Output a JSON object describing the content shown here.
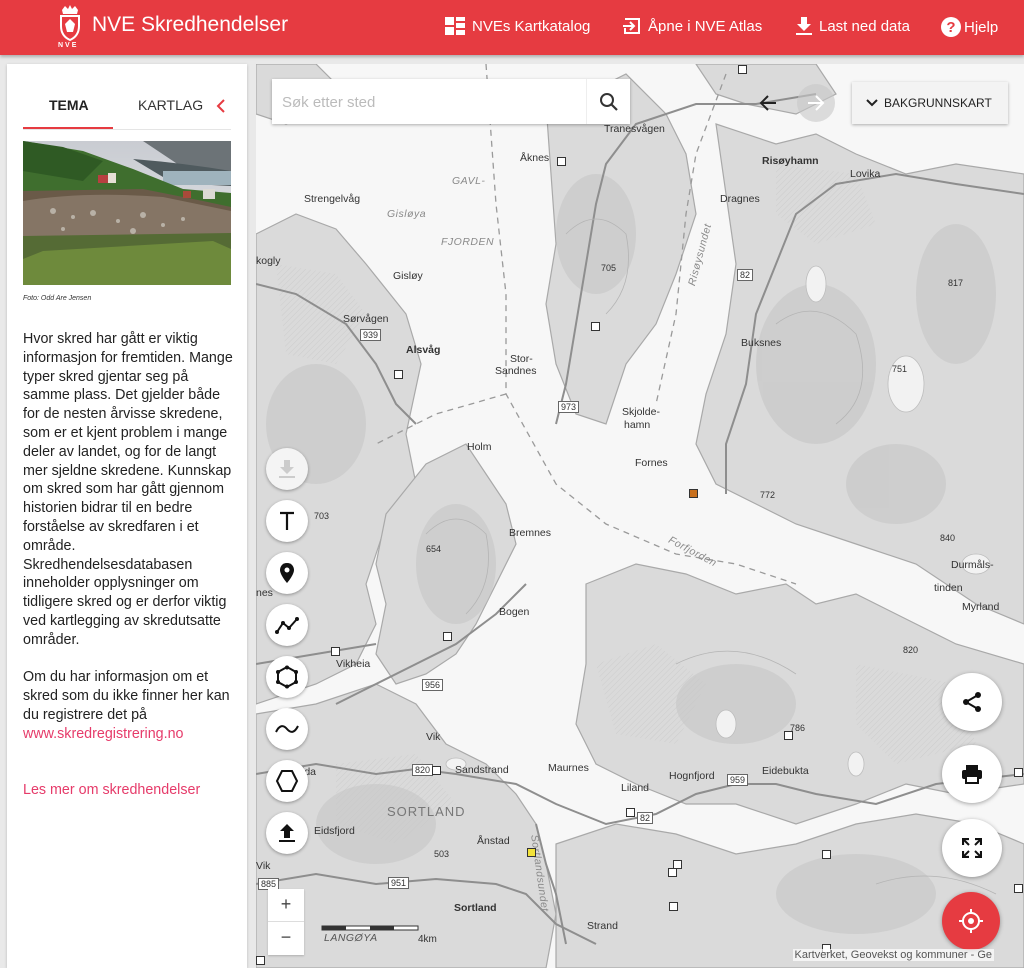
{
  "header": {
    "logo_text": "NVE",
    "title": "NVE Skredhendelser",
    "nav": [
      {
        "label": "NVEs Kartkatalog",
        "icon": "grid-icon"
      },
      {
        "label": "Åpne i NVE Atlas",
        "icon": "open-in-icon"
      },
      {
        "label": "Last ned data",
        "icon": "download-icon"
      },
      {
        "label": "Hjelp",
        "icon": "help-icon"
      }
    ]
  },
  "sidebar": {
    "tabs": [
      "TEMA",
      "KARTLAG"
    ],
    "active_tab": "TEMA",
    "photo_credit": "Foto: Odd Are Jensen",
    "intro": "Hvor skred har gått er viktig informasjon for fremtiden. Mange typer skred gjentar seg på samme plass. Det gjelder både for de nesten årvisse skredene, som er et kjent problem i mange deler av landet, og for de langt mer sjeldne skredene. Kunnskap om skred som har gått gjennom historien bidrar til en bedre forståelse av skredfaren i et område. Skredhendelsesdatabasen inneholder opplysninger om tidligere skred og er derfor viktig ved kartlegging av skredutsatte områder.",
    "register_text": "Om du har informasjon om et skred som du ikke finner her kan du registrere det på",
    "register_link": "www.skredregistrering.no",
    "read_more": "Les mer om skredhendelser"
  },
  "map": {
    "search_placeholder": "Søk etter sted",
    "basemap_button": "BAKGRUNNSKART",
    "scale_label": "4km",
    "attribution": "Kartverket, Geovekst og kommuner - Ge",
    "places": [
      {
        "name": "Tranesvågen"
      },
      {
        "name": "Åknes"
      },
      {
        "name": "Risøyhamn"
      },
      {
        "name": "Lovika"
      },
      {
        "name": "GAVL-"
      },
      {
        "name": "Strengelvåg"
      },
      {
        "name": "Gisløya"
      },
      {
        "name": "Dragnes"
      },
      {
        "name": "FJORDEN"
      },
      {
        "name": "kogly"
      },
      {
        "name": "Gisløy"
      },
      {
        "name": "705"
      },
      {
        "name": "817"
      },
      {
        "name": "Risøysundet"
      },
      {
        "name": "Sørvågen"
      },
      {
        "name": "Alsvåg"
      },
      {
        "name": "Buksnes"
      },
      {
        "name": "Stor-"
      },
      {
        "name": "Sandnes"
      },
      {
        "name": "751"
      },
      {
        "name": "Skjolde-"
      },
      {
        "name": "hamn"
      },
      {
        "name": "Holm"
      },
      {
        "name": "Fornes"
      },
      {
        "name": "772"
      },
      {
        "name": "703"
      },
      {
        "name": "Bremnes"
      },
      {
        "name": "654"
      },
      {
        "name": "Forfjorden"
      },
      {
        "name": "840"
      },
      {
        "name": "Durmåls-"
      },
      {
        "name": "tinden"
      },
      {
        "name": "nes"
      },
      {
        "name": "Myrland"
      },
      {
        "name": "Bogen"
      },
      {
        "name": "Vikheia"
      },
      {
        "name": "820"
      },
      {
        "name": "786"
      },
      {
        "name": "Vik"
      },
      {
        "name": "Sandstrand"
      },
      {
        "name": "Maurnes"
      },
      {
        "name": "Hognfjord"
      },
      {
        "name": "Eidebukta"
      },
      {
        "name": "Liland"
      },
      {
        "name": "SORTLAND"
      },
      {
        "name": "Eidsfjord"
      },
      {
        "name": "Ånstad"
      },
      {
        "name": "503"
      },
      {
        "name": "Sortland"
      },
      {
        "name": "Sortlandsundet"
      },
      {
        "name": "Strand"
      },
      {
        "name": "LANGØYA"
      },
      {
        "name": "Vik"
      },
      {
        "name": "ida"
      }
    ],
    "roads": [
      "939",
      "973",
      "82",
      "956",
      "820",
      "959",
      "82",
      "951",
      "885"
    ]
  }
}
